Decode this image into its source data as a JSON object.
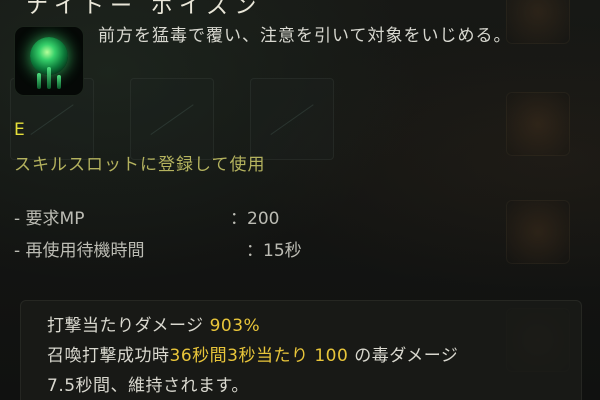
{
  "skill": {
    "title_fragment": "ナイトー ポイズン",
    "description": "前方を猛毒で覆い、注意を引いて対象をいじめる。",
    "hotkey": "E",
    "register_hint": "スキルスロットに登録して使用"
  },
  "stats": [
    {
      "label": "- 要求MP",
      "value": "：200"
    },
    {
      "label": "- 再使用待機時間",
      "value": "：15秒"
    }
  ],
  "effects": {
    "line1_text": "打撃当たりダメージ ",
    "line1_value": "903%",
    "line2_text_a": "召喚打撃成功時",
    "line2_highlight": "36秒間3秒当たり 100",
    "line2_text_b": " の毒ダメージ",
    "line3_text": "7.5秒間、維持されます。"
  },
  "colors": {
    "hotkey": "#e6df3a",
    "register_hint": "#b4b25e",
    "highlight": "#e8c53a",
    "icon_glow": "#36d06a"
  },
  "icons": {
    "skill_icon": "poison-orb-icon"
  }
}
